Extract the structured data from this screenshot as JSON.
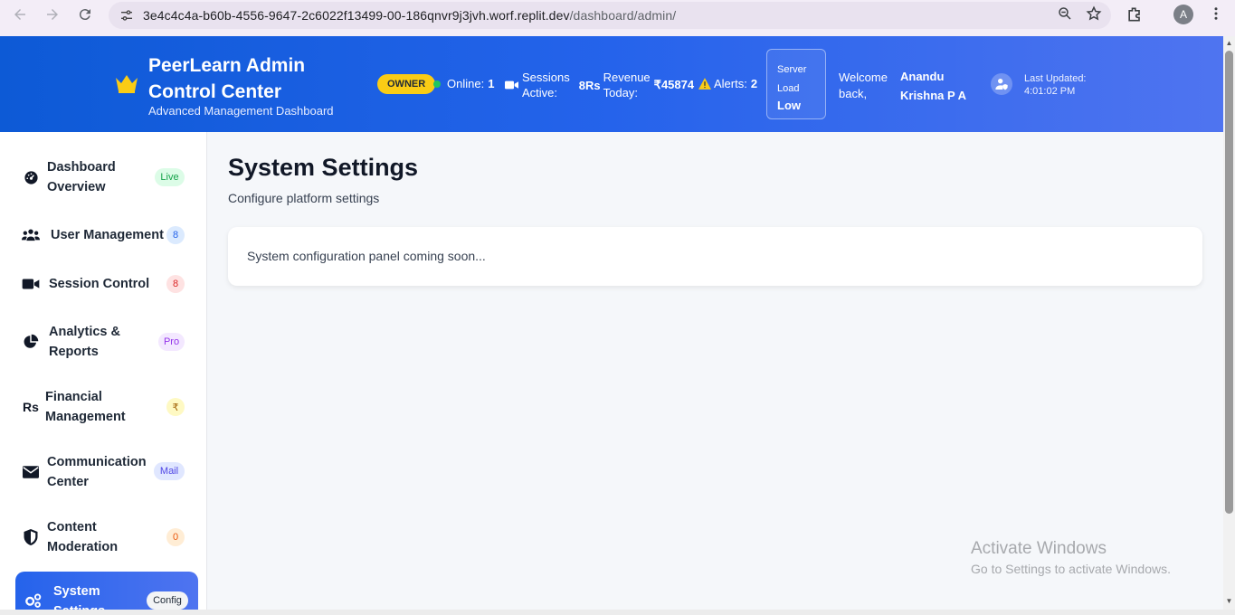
{
  "browser": {
    "url_host": "3e4c4c4a-b60b-4556-9647-2c6022f13499-00-186qnvr9j3jvh.worf.replit.dev",
    "url_path": "/dashboard/admin/",
    "profile_initial": "A"
  },
  "header": {
    "title": "PeerLearn Admin Control Center",
    "subtitle": "Advanced Management Dashboard",
    "role_badge": "OWNER",
    "online_label": "Online:",
    "online_value": "1",
    "sessions_label": "Sessions Active:",
    "sessions_value": "8",
    "revenue_label": "Revenue Today:",
    "revenue_value": "₹45874",
    "alerts_label": "Alerts:",
    "alerts_value": "2",
    "server_label_1": "Server",
    "server_label_2": "Load",
    "server_value": "Low",
    "welcome_text": "Welcome back,",
    "user_name": "Anandu Krishna P A",
    "last_updated_label": "Last Updated:",
    "last_updated_time": "4:01:02 PM",
    "rupee_symbol": "Rs"
  },
  "sidebar": {
    "items": [
      {
        "label": "Dashboard Overview",
        "badge": "Live",
        "icon": "gauge-icon"
      },
      {
        "label": "User Management",
        "badge": "8",
        "icon": "users-icon"
      },
      {
        "label": "Session Control",
        "badge": "8",
        "icon": "video-icon"
      },
      {
        "label": "Analytics & Reports",
        "badge": "Pro",
        "icon": "pie-chart-icon"
      },
      {
        "label": "Financial Management",
        "badge": "₹",
        "icon": "rupee-icon"
      },
      {
        "label": "Communication Center",
        "badge": "Mail",
        "icon": "envelope-icon"
      },
      {
        "label": "Content Moderation",
        "badge": "0",
        "icon": "shield-icon"
      },
      {
        "label": "System Settings",
        "badge": "Config",
        "icon": "gears-icon"
      }
    ]
  },
  "main": {
    "title": "System Settings",
    "subtitle": "Configure platform settings",
    "panel_text": "System configuration panel coming soon..."
  },
  "watermark": {
    "title": "Activate Windows",
    "subtitle": "Go to Settings to activate Windows."
  },
  "colors": {
    "header_start": "#0d5ad6",
    "header_end": "#4f74f0",
    "owner_badge": "#facc15",
    "online_dot": "#22c55e"
  }
}
